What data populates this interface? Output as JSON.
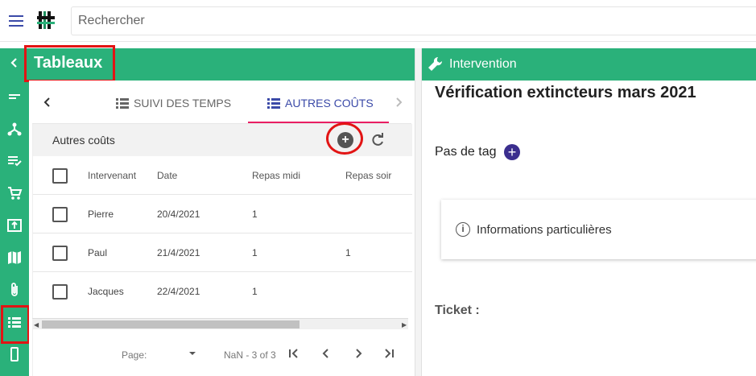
{
  "topbar": {
    "search_placeholder": "Rechercher"
  },
  "left_panel": {
    "title": "Tableaux",
    "tabs": [
      {
        "label": "SUIVI DES TEMPS",
        "active": false
      },
      {
        "label": "AUTRES COÛTS",
        "active": true
      }
    ],
    "card_title": "Autres coûts",
    "columns": [
      "Intervenant",
      "Date",
      "Repas midi",
      "Repas soir"
    ],
    "rows": [
      {
        "intervenant": "Pierre",
        "date": "20/4/2021",
        "repas_midi": "1",
        "repas_soir": ""
      },
      {
        "intervenant": "Paul",
        "date": "21/4/2021",
        "repas_midi": "1",
        "repas_soir": "1"
      },
      {
        "intervenant": "Jacques",
        "date": "22/4/2021",
        "repas_midi": "1",
        "repas_soir": ""
      }
    ],
    "pager": {
      "page_label": "Page:",
      "range": "NaN - 3 of 3"
    }
  },
  "right_panel": {
    "header": "Intervention",
    "doc_title": "Vérification extincteurs mars 2021",
    "tag_label": "Pas de tag",
    "info_label": "Informations particulières",
    "ticket_label": "Ticket :"
  },
  "colors": {
    "primary_green": "#2ab17a",
    "accent_blue": "#3b4aa8",
    "highlight_red": "#e21414",
    "tab_underline": "#e91e63"
  }
}
